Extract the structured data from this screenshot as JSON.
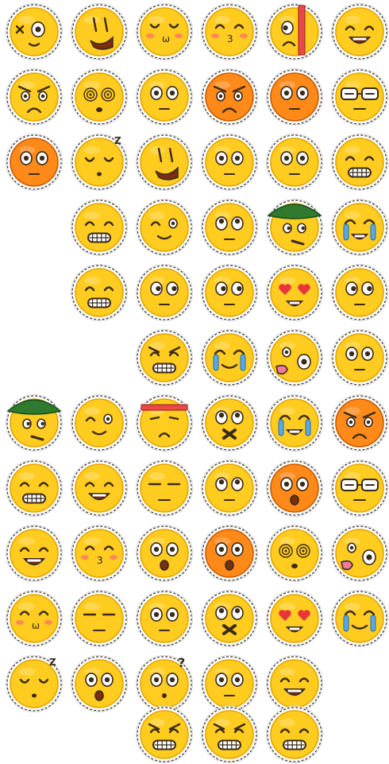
{
  "sheet": {
    "title": "",
    "colors": {
      "face": "#ffcc1f",
      "face_shadow": "#e6a400",
      "face_alt": "#ff8a1a",
      "outline": "#3a2a1a",
      "sticker_border": "#ffffff",
      "dash": "#333333",
      "blush": "#ff6f6f",
      "heart": "#e8343b",
      "tear": "#5aa9e6",
      "hat": "#2f7a2f",
      "headband": "#e84a4a"
    },
    "rows": [
      {
        "items": [
          {
            "expr": "x-eye-surprised"
          },
          {
            "expr": "sly-squint"
          },
          {
            "expr": "shy-blush"
          },
          {
            "expr": "cute-kiss"
          },
          {
            "expr": "red-bar-frown"
          },
          {
            "expr": "side-laugh"
          }
        ]
      },
      {
        "items": [
          {
            "expr": "angry-frown"
          },
          {
            "expr": "spiral-dizzy"
          },
          {
            "expr": "sweat-drops"
          },
          {
            "expr": "orange-angry"
          },
          {
            "expr": "orange-surprised"
          },
          {
            "expr": "glasses-squint"
          }
        ]
      },
      {
        "items": [
          {
            "expr": "orange-shout"
          },
          {
            "expr": "sleepy-zzz"
          },
          {
            "expr": "side-grin"
          },
          {
            "expr": "calm-smile"
          },
          {
            "expr": "wide-eyes"
          },
          {
            "expr": "teeth-grin"
          }
        ]
      },
      {
        "items": [
          {
            "expr": "teeth-clench"
          },
          {
            "expr": "wink-smile"
          },
          {
            "expr": "looking-up"
          },
          {
            "expr": "green-hat-side"
          },
          {
            "expr": "crying-laugh"
          }
        ]
      },
      {
        "items": [
          {
            "expr": "grit-teeth"
          },
          {
            "expr": "worried-side"
          },
          {
            "expr": "pointing"
          },
          {
            "expr": "heart-eyes-side"
          },
          {
            "expr": "big-eyes-side"
          }
        ]
      },
      {
        "items": [
          {
            "expr": "angry-teeth"
          },
          {
            "expr": "crying-tears"
          },
          {
            "expr": "tongue-out"
          },
          {
            "expr": "doubtful"
          }
        ]
      },
      {
        "items": [
          {
            "expr": "green-hat-smoke"
          },
          {
            "expr": "wink"
          },
          {
            "expr": "headband-sad"
          },
          {
            "expr": "mouth-taped"
          },
          {
            "expr": "laughing-tears"
          },
          {
            "expr": "orange-mad"
          }
        ]
      },
      {
        "items": [
          {
            "expr": "big-grin"
          },
          {
            "expr": "squint-laugh"
          },
          {
            "expr": "bored"
          },
          {
            "expr": "rolling-eyes"
          },
          {
            "expr": "orange-shocked"
          },
          {
            "expr": "glasses-nerd"
          }
        ]
      },
      {
        "items": [
          {
            "expr": "happy-smile"
          },
          {
            "expr": "kiss-closed"
          },
          {
            "expr": "startled"
          },
          {
            "expr": "orange-scared"
          },
          {
            "expr": "spiral-eyes"
          },
          {
            "expr": "tongue-side"
          }
        ]
      },
      {
        "items": [
          {
            "expr": "yum"
          },
          {
            "expr": "unimpressed"
          },
          {
            "expr": "dazed-blush"
          },
          {
            "expr": "shh"
          },
          {
            "expr": "heart-eyes-drool"
          },
          {
            "expr": "crying-side"
          }
        ]
      },
      {
        "items": [
          {
            "expr": "sleeping-zz"
          },
          {
            "expr": "gasp"
          },
          {
            "expr": "question-confused"
          },
          {
            "expr": "plain-stare"
          },
          {
            "expr": "content-smile"
          }
        ]
      },
      {
        "items": [
          {
            "expr": "angry-grin"
          },
          {
            "expr": "evil-grin"
          },
          {
            "expr": "nervous-grin"
          }
        ]
      }
    ]
  }
}
